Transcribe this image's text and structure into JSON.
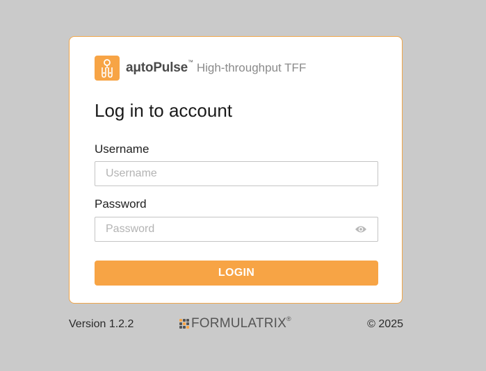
{
  "header": {
    "brand_name": "aμtoPulse",
    "brand_tm": "™",
    "brand_tagline": "High-throughput TFF"
  },
  "form": {
    "title": "Log in to account",
    "username_label": "Username",
    "username_placeholder": "Username",
    "username_value": "",
    "password_label": "Password",
    "password_placeholder": "Password",
    "password_value": "",
    "login_label": "LOGIN"
  },
  "footer": {
    "version": "Version 1.2.2",
    "company": "FORMULATRIX",
    "company_reg": "®",
    "copyright": "© 2025"
  },
  "icons": {
    "brand_logo": "autopulse-logo-icon",
    "password_toggle": "eye-icon",
    "company_logo": "formulatrix-logo-icon"
  },
  "colors": {
    "background": "#cacaca",
    "accent": "#f7a445",
    "card_border": "#f0a64a",
    "card": "#ffffff"
  }
}
